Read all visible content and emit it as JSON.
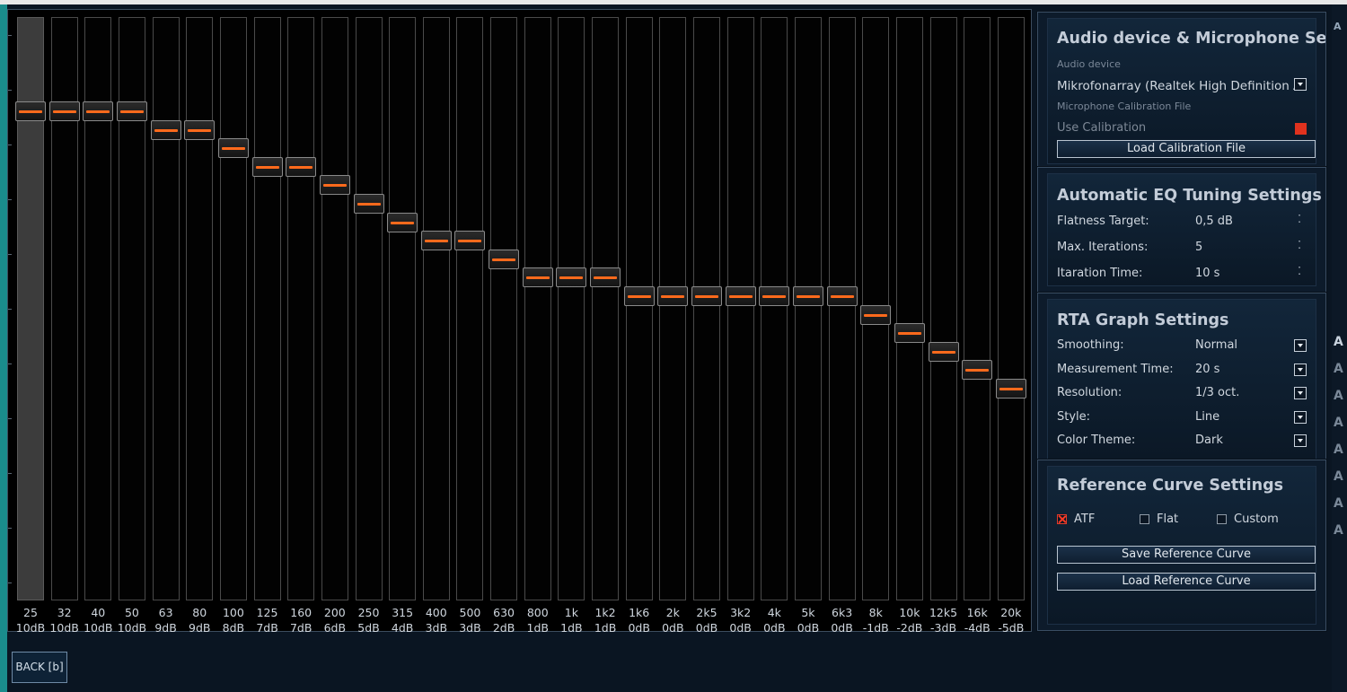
{
  "eq": {
    "bands": [
      {
        "freq": "25",
        "gain": "10dB",
        "db": 10,
        "selected": true
      },
      {
        "freq": "32",
        "gain": "10dB",
        "db": 10
      },
      {
        "freq": "40",
        "gain": "10dB",
        "db": 10
      },
      {
        "freq": "50",
        "gain": "10dB",
        "db": 10
      },
      {
        "freq": "63",
        "gain": "9dB",
        "db": 9
      },
      {
        "freq": "80",
        "gain": "9dB",
        "db": 9
      },
      {
        "freq": "100",
        "gain": "8dB",
        "db": 8
      },
      {
        "freq": "125",
        "gain": "7dB",
        "db": 7
      },
      {
        "freq": "160",
        "gain": "7dB",
        "db": 7
      },
      {
        "freq": "200",
        "gain": "6dB",
        "db": 6
      },
      {
        "freq": "250",
        "gain": "5dB",
        "db": 5
      },
      {
        "freq": "315",
        "gain": "4dB",
        "db": 4
      },
      {
        "freq": "400",
        "gain": "3dB",
        "db": 3
      },
      {
        "freq": "500",
        "gain": "3dB",
        "db": 3
      },
      {
        "freq": "630",
        "gain": "2dB",
        "db": 2
      },
      {
        "freq": "800",
        "gain": "1dB",
        "db": 1
      },
      {
        "freq": "1k",
        "gain": "1dB",
        "db": 1
      },
      {
        "freq": "1k2",
        "gain": "1dB",
        "db": 1
      },
      {
        "freq": "1k6",
        "gain": "0dB",
        "db": 0
      },
      {
        "freq": "2k",
        "gain": "0dB",
        "db": 0
      },
      {
        "freq": "2k5",
        "gain": "0dB",
        "db": 0
      },
      {
        "freq": "3k2",
        "gain": "0dB",
        "db": 0
      },
      {
        "freq": "4k",
        "gain": "0dB",
        "db": 0
      },
      {
        "freq": "5k",
        "gain": "0dB",
        "db": 0
      },
      {
        "freq": "6k3",
        "gain": "0dB",
        "db": 0
      },
      {
        "freq": "8k",
        "gain": "-1dB",
        "db": -1
      },
      {
        "freq": "10k",
        "gain": "-2dB",
        "db": -2
      },
      {
        "freq": "12k5",
        "gain": "-3dB",
        "db": -3
      },
      {
        "freq": "16k",
        "gain": "-4dB",
        "db": -4
      },
      {
        "freq": "20k",
        "gain": "-5dB",
        "db": -5
      }
    ]
  },
  "audio_device": {
    "title": "Audio device & Microphone Set",
    "device_label": "Audio device",
    "device_value": "Mikrofonarray (Realtek High Definition Aud",
    "calibration_label": "Microphone Calibration File",
    "use_calibration": "Use Calibration",
    "load_calibration": "Load Calibration File"
  },
  "auto_eq": {
    "title": "Automatic EQ Tuning Settings",
    "rows": [
      {
        "label": "Flatness Target:",
        "value": "0,5 dB"
      },
      {
        "label": "Max. Iterations:",
        "value": "5"
      },
      {
        "label": "Itaration Time:",
        "value": "10 s"
      }
    ]
  },
  "rta": {
    "title": "RTA Graph Settings",
    "rows": [
      {
        "label": "Smoothing:",
        "value": "Normal"
      },
      {
        "label": "Measurement Time:",
        "value": "20 s"
      },
      {
        "label": "Resolution:",
        "value": "1/3 oct."
      },
      {
        "label": "Style:",
        "value": "Line"
      },
      {
        "label": "Color Theme:",
        "value": "Dark"
      }
    ]
  },
  "reference": {
    "title": "Reference Curve Settings",
    "options": [
      {
        "label": "ATF",
        "checked": true
      },
      {
        "label": "Flat",
        "checked": false
      },
      {
        "label": "Custom",
        "checked": false
      }
    ],
    "save": "Save Reference Curve",
    "load": "Load Reference Curve"
  },
  "footer": {
    "back": "BACK [b]"
  },
  "colors": {
    "accent": "#ff6a1c",
    "check": "#ff3a24",
    "calibration_indicator": "#e0321e"
  }
}
